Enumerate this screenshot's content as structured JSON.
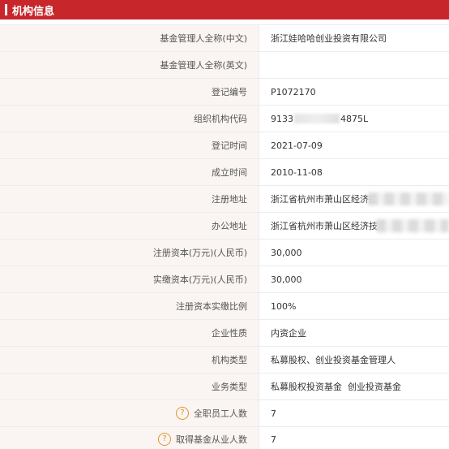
{
  "header": {
    "title": "机构信息"
  },
  "rows": [
    {
      "label": "基金管理人全称(中文)",
      "value": "浙江娃哈哈创业投资有限公司"
    },
    {
      "label": "基金管理人全称(英文)",
      "value": ""
    },
    {
      "label": "登记编号",
      "value": "P1072170"
    },
    {
      "label": "组织机构代码",
      "value_prefix": "9133",
      "value_suffix": "4875L"
    },
    {
      "label": "登记时间",
      "value": "2021-07-09"
    },
    {
      "label": "成立时间",
      "value": "2010-11-08"
    },
    {
      "label": "注册地址",
      "value": "浙江省杭州市萧山区经济技"
    },
    {
      "label": "办公地址",
      "value": "浙江省杭州市萧山区经济技术"
    },
    {
      "label": "注册资本(万元)(人民币)",
      "value": "30,000"
    },
    {
      "label": "实缴资本(万元)(人民币)",
      "value": "30,000"
    },
    {
      "label": "注册资本实缴比例",
      "value": "100%"
    },
    {
      "label": "企业性质",
      "value": "内资企业"
    },
    {
      "label": "机构类型",
      "value": "私募股权、创业投资基金管理人"
    },
    {
      "label": "业务类型",
      "value": "私募股权投资基金  创业投资基金"
    },
    {
      "label": "全职员工人数",
      "value": "7",
      "help_icon": "?"
    },
    {
      "label": "取得基金从业人数",
      "value": "7",
      "help_icon": "?"
    }
  ],
  "colors": {
    "header_bg": "#c7262b",
    "label_bg": "#faf5f2",
    "help": "#e0952b"
  }
}
